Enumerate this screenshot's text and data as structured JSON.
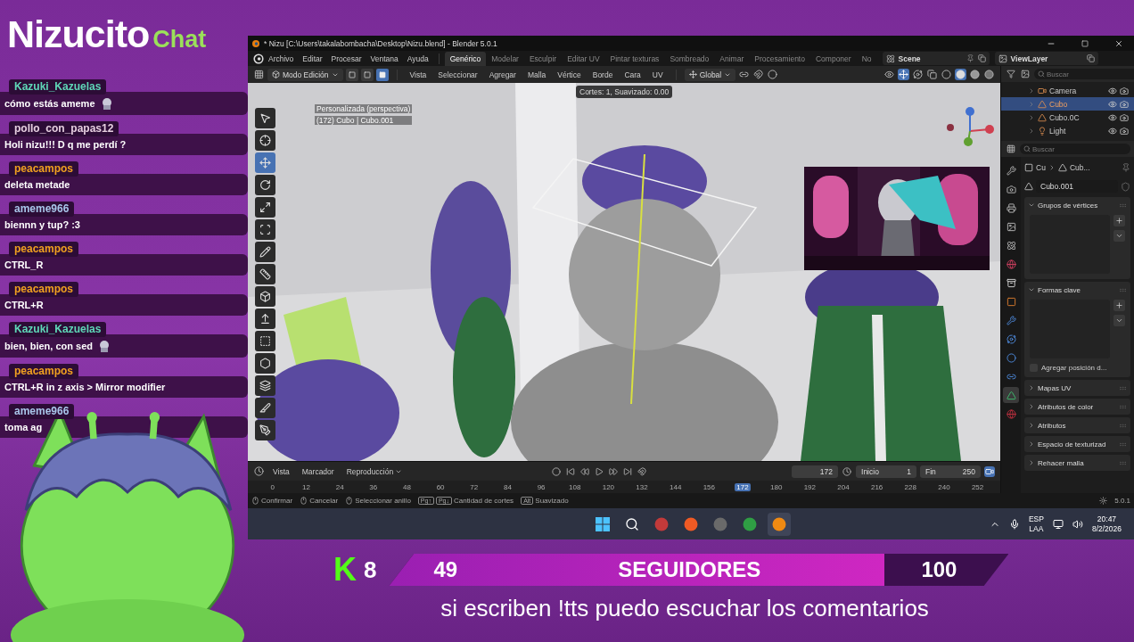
{
  "stream": {
    "logo": {
      "name": "Nizucito",
      "suffix": "Chat"
    }
  },
  "chat": [
    {
      "user": "Kazuki_Kazuelas",
      "color": "#5fd8b8",
      "text": "cómo estás ameme",
      "emote": true
    },
    {
      "user": "pollo_con_papas12",
      "color": "#e6cfe0",
      "text": "Holi nizu!!! D q me perdí ?",
      "emote": false
    },
    {
      "user": "peacampos",
      "color": "#f0a020",
      "text": "deleta metade",
      "emote": false
    },
    {
      "user": "ameme966",
      "color": "#a9c6ea",
      "text": "biennn y tup? :3",
      "emote": false
    },
    {
      "user": "peacampos",
      "color": "#f0a020",
      "text": "CTRL_R",
      "emote": false
    },
    {
      "user": "peacampos",
      "color": "#f0a020",
      "text": "CTRL+R",
      "emote": false
    },
    {
      "user": "Kazuki_Kazuelas",
      "color": "#5fd8b8",
      "text": "bien, bien, con sed",
      "emote": true
    },
    {
      "user": "peacampos",
      "color": "#f0a020",
      "text": "CTRL+R in z axis > Mirror modifier",
      "emote": false
    },
    {
      "user": "ameme966",
      "color": "#a9c6ea",
      "text": "toma ag",
      "emote": false
    }
  ],
  "blender": {
    "title": "* Nizu [C:\\Users\\takalabombacha\\Desktop\\Nizu.blend] - Blender 5.0.1",
    "menus": [
      "Archivo",
      "Editar",
      "Procesar",
      "Ventana",
      "Ayuda"
    ],
    "workspaces": [
      {
        "label": "Genérico",
        "selected": true
      },
      {
        "label": "Modelar",
        "selected": false
      },
      {
        "label": "Esculpir",
        "selected": false
      },
      {
        "label": "Editar UV",
        "selected": false
      },
      {
        "label": "Pintar texturas",
        "selected": false
      },
      {
        "label": "Sombreado",
        "selected": false
      },
      {
        "label": "Animar",
        "selected": false
      },
      {
        "label": "Procesamiento",
        "selected": false
      },
      {
        "label": "Componer",
        "selected": false
      },
      {
        "label": "No",
        "selected": false
      }
    ],
    "scene": "Scene",
    "view_layer": "ViewLayer",
    "viewport_header": {
      "mode": "Modo Edición",
      "select_modes": [
        {
          "kind": "vertex",
          "selected": false
        },
        {
          "kind": "edge",
          "selected": false
        },
        {
          "kind": "face",
          "selected": true
        }
      ],
      "menus": [
        "Vista",
        "Seleccionar",
        "Agregar",
        "Malla",
        "Vértice",
        "Borde",
        "Cara",
        "UV"
      ],
      "orientation": "Global",
      "shading": [
        {
          "kind": "wireframe",
          "selected": false
        },
        {
          "kind": "solid",
          "selected": true
        },
        {
          "kind": "material",
          "selected": false
        },
        {
          "kind": "rendered",
          "selected": false
        }
      ]
    },
    "viewport": {
      "view_name": "Personalizada (perspectiva)",
      "object_info": "(172) Cubo | Cubo.001",
      "operator_info": "Cortes: 1, Suavizado: 0.00",
      "tools": [
        {
          "kind": "select",
          "selected": false
        },
        {
          "kind": "cursor",
          "selected": false
        },
        {
          "kind": "move",
          "selected": true
        },
        {
          "kind": "rotate",
          "selected": false
        },
        {
          "kind": "scale",
          "selected": false
        },
        {
          "kind": "transform",
          "selected": false
        },
        {
          "kind": "annotate",
          "selected": false
        },
        {
          "kind": "measure",
          "selected": false
        },
        {
          "kind": "add",
          "selected": false
        },
        {
          "kind": "extrude",
          "selected": false
        },
        {
          "kind": "inset",
          "selected": false
        },
        {
          "kind": "bevel",
          "selected": false
        },
        {
          "kind": "loopcut",
          "selected": false
        },
        {
          "kind": "knife",
          "selected": false
        },
        {
          "kind": "polybuild",
          "selected": false
        }
      ]
    },
    "outliner": {
      "search_placeholder": "Buscar",
      "items": [
        {
          "name": "Camera",
          "kind": "camera",
          "selected": false
        },
        {
          "name": "Cubo",
          "kind": "mesh",
          "selected": true
        },
        {
          "name": "Cubo.0C",
          "kind": "mesh",
          "selected": false
        },
        {
          "name": "Light",
          "kind": "light",
          "selected": false
        }
      ]
    },
    "properties": {
      "search_placeholder": "Buscar",
      "breadcrumb": [
        "Cu",
        "Cub..."
      ],
      "mesh_name": "Cubo.001",
      "tabs": [
        {
          "kind": "tool",
          "selected": false
        },
        {
          "kind": "render",
          "selected": false
        },
        {
          "kind": "output",
          "selected": false
        },
        {
          "kind": "view",
          "selected": false
        },
        {
          "kind": "scene",
          "selected": false
        },
        {
          "kind": "world",
          "selected": false
        },
        {
          "kind": "collection",
          "selected": false
        },
        {
          "kind": "object",
          "selected": false
        },
        {
          "kind": "modifier",
          "selected": false
        },
        {
          "kind": "particles",
          "selected": false
        },
        {
          "kind": "physics",
          "selected": false
        },
        {
          "kind": "constraints",
          "selected": false
        },
        {
          "kind": "data",
          "selected": true
        },
        {
          "kind": "material",
          "selected": false
        }
      ],
      "panels": [
        {
          "label": "Grupos de vértices",
          "expanded": true
        },
        {
          "label": "Formas clave",
          "expanded": true,
          "checkbox": {
            "label": "Agregar posición d...",
            "checked": false
          }
        },
        {
          "label": "Mapas UV",
          "expanded": false
        },
        {
          "label": "Atributos de color",
          "expanded": false
        },
        {
          "label": "Atributos",
          "expanded": false
        },
        {
          "label": "Espacio de texturizad",
          "expanded": false
        },
        {
          "label": "Rehacer malla",
          "expanded": false
        }
      ]
    },
    "timeline": {
      "menus": [
        "Vista",
        "Marcador",
        "Reproducción"
      ],
      "current_frame": "172",
      "start_label": "Inicio",
      "start": "1",
      "end_label": "Fin",
      "end": "250",
      "ticks": [
        {
          "label": "0",
          "selected": false
        },
        {
          "label": "12",
          "selected": false
        },
        {
          "label": "24",
          "selected": false
        },
        {
          "label": "36",
          "selected": false
        },
        {
          "label": "48",
          "selected": false
        },
        {
          "label": "60",
          "selected": false
        },
        {
          "label": "72",
          "selected": false
        },
        {
          "label": "84",
          "selected": false
        },
        {
          "label": "96",
          "selected": false
        },
        {
          "label": "108",
          "selected": false
        },
        {
          "label": "120",
          "selected": false
        },
        {
          "label": "132",
          "selected": false
        },
        {
          "label": "144",
          "selected": false
        },
        {
          "label": "156",
          "selected": false
        },
        {
          "label": "172",
          "selected": true
        },
        {
          "label": "180",
          "selected": false
        },
        {
          "label": "192",
          "selected": false
        },
        {
          "label": "204",
          "selected": false
        },
        {
          "label": "216",
          "selected": false
        },
        {
          "label": "228",
          "selected": false
        },
        {
          "label": "240",
          "selected": false
        },
        {
          "label": "252",
          "selected": false
        }
      ]
    },
    "status": {
      "items": [
        {
          "kind": "mouse",
          "label": "Confirmar"
        },
        {
          "kind": "mouse",
          "label": "Cancelar"
        },
        {
          "kind": "mouse",
          "label": "Seleccionar anillo"
        },
        {
          "kind": "keys",
          "keys": [
            "Pg↑",
            "Pg↓"
          ],
          "label": "Cantidad de cortes"
        },
        {
          "kind": "keys",
          "keys": [
            "Alt"
          ],
          "label": "Suavizado"
        }
      ],
      "version": "5.0.1"
    }
  },
  "taskbar": {
    "apps": [
      {
        "kind": "windows",
        "selected": false
      },
      {
        "kind": "search",
        "selected": false
      },
      {
        "kind": "app",
        "color": "#c23a3a",
        "selected": false
      },
      {
        "kind": "app",
        "color": "#f05a24",
        "selected": false
      },
      {
        "kind": "app",
        "color": "#6a6a6a",
        "selected": false
      },
      {
        "kind": "app",
        "color": "#2f9e44",
        "selected": false
      },
      {
        "kind": "app",
        "color": "#f08a12",
        "selected": true
      }
    ],
    "language": [
      "ESP",
      "LAA"
    ],
    "time": "20:47",
    "date": "8/2/2026"
  },
  "follow_goal": {
    "mark": "K",
    "count": "8",
    "current": "49",
    "label": "SEGUIDORES",
    "goal": "100",
    "level": 0.8
  },
  "caption": "si escriben !tts puedo escuchar los comentarios"
}
